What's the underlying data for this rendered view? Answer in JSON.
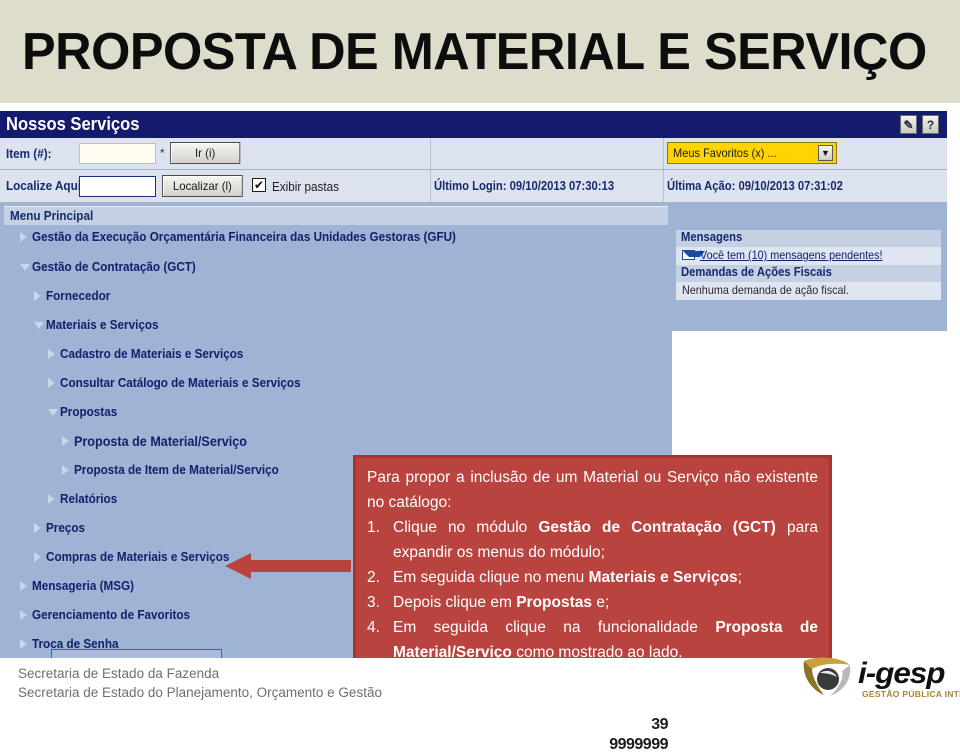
{
  "title_banner": {
    "title": "PROPOSTA DE MATERIAL E SERVIÇO",
    "background_color": "#dedccb"
  },
  "app": {
    "titlebar": {
      "title": "Nossos Serviços",
      "background_color": "#141a6e",
      "icons": [
        {
          "name": "note-icon",
          "glyph": "✎"
        },
        {
          "name": "help-icon",
          "glyph": "?"
        }
      ]
    },
    "toolbar": {
      "item_label": "Item (#):",
      "item_value": "",
      "item_required_marker": "*",
      "go_button": "Ir (i)",
      "localize_label": "Localize Aqui:",
      "localize_value": "",
      "localize_button": "Localizar (l)",
      "show_folders_label": "Exibir pastas",
      "show_folders_checked": true,
      "show_folders_glyph": "✔",
      "favorites_label": "Meus Favoritos (x) ...",
      "favorites_arrow": "▼",
      "favorites_color": "#ffd400",
      "last_login": "Último Login: 09/10/2013 07:30:13",
      "last_action": "Última Ação: 09/10/2013 07:31:02"
    },
    "menu": {
      "header": "Menu Principal",
      "items": [
        {
          "label": "Gestão da Execução Orçamentária Financeira das Unidades Gestoras (GFU)",
          "level": 0,
          "state": "collapsed"
        },
        {
          "label": "Gestão de Contratação (GCT)",
          "level": 0,
          "state": "expanded"
        },
        {
          "label": "Fornecedor",
          "level": 1,
          "state": "collapsed"
        },
        {
          "label": "Materiais e Serviços",
          "level": 1,
          "state": "expanded"
        },
        {
          "label": "Cadastro de Materiais e Serviços",
          "level": 2,
          "state": "collapsed"
        },
        {
          "label": "Consultar Catálogo de Materiais e Serviços",
          "level": 2,
          "state": "collapsed"
        },
        {
          "label": "Propostas",
          "level": 2,
          "state": "expanded"
        },
        {
          "label": "Proposta de Material/Serviço",
          "level": 3,
          "state": "collapsed",
          "highlighted": true
        },
        {
          "label": "Proposta de Item de Material/Serviço",
          "level": 3,
          "state": "collapsed"
        },
        {
          "label": "Relatórios",
          "level": 2,
          "state": "collapsed"
        },
        {
          "label": "Preços",
          "level": 1,
          "state": "collapsed"
        },
        {
          "label": "Compras de Materiais e Serviços",
          "level": 1,
          "state": "collapsed"
        },
        {
          "label": "Mensageria (MSG)",
          "level": 0,
          "state": "collapsed"
        },
        {
          "label": "Gerenciamento de Favoritos",
          "level": 0,
          "state": "collapsed"
        },
        {
          "label": "Troca de Senha",
          "level": 0,
          "state": "collapsed"
        }
      ],
      "bottom_number_1": "39",
      "bottom_number_2": "9999999"
    },
    "messages_panel": {
      "messages_header": "Mensagens",
      "messages_link": "Você tem (10) mensagens pendentes!",
      "fiscal_header": "Demandas de Ações Fiscais",
      "fiscal_empty": "Nenhuma demanda de ação fiscal."
    }
  },
  "callout": {
    "background_color": "#b9433f",
    "border_color": "#a8332f",
    "intro_line_1": "Para propor a inclusão de um Material ou Serviço",
    "intro_line_2": "não existente no catálogo:",
    "steps": [
      {
        "num": "1.",
        "parts": [
          {
            "t": "Clique no módulo ",
            "b": false
          },
          {
            "t": "Gestão de Contratação (GCT)",
            "b": true
          },
          {
            "t": " para expandir os menus do módulo;",
            "b": false
          }
        ]
      },
      {
        "num": "2.",
        "parts": [
          {
            "t": "Em seguida clique no menu ",
            "b": false
          },
          {
            "t": "Materiais e Serviços",
            "b": true
          },
          {
            "t": ";",
            "b": false
          }
        ]
      },
      {
        "num": "3.",
        "parts": [
          {
            "t": "Depois clique em ",
            "b": false
          },
          {
            "t": "Propostas",
            "b": true
          },
          {
            "t": " e;",
            "b": false
          }
        ]
      },
      {
        "num": "4.",
        "parts": [
          {
            "t": "Em seguida clique na funcionalidade ",
            "b": false
          },
          {
            "t": "Proposta de Material/Serviço",
            "b": true
          },
          {
            "t": " como mostrado ao lado.",
            "b": false
          }
        ]
      }
    ]
  },
  "annotation": {
    "arrow_color": "#b9433f",
    "arrow_direction": "left",
    "highlight_border_color": "#c0392b"
  },
  "footer": {
    "line_1": "Secretaria de Estado da Fazenda",
    "line_2": "Secretaria de Estado do Planejamento, Orçamento e Gestão",
    "logo_text": "i-gesp",
    "logo_tagline": "GESTÃO PÚBLICA INTEGRADA",
    "logo_accent_color": "#a8842c"
  }
}
